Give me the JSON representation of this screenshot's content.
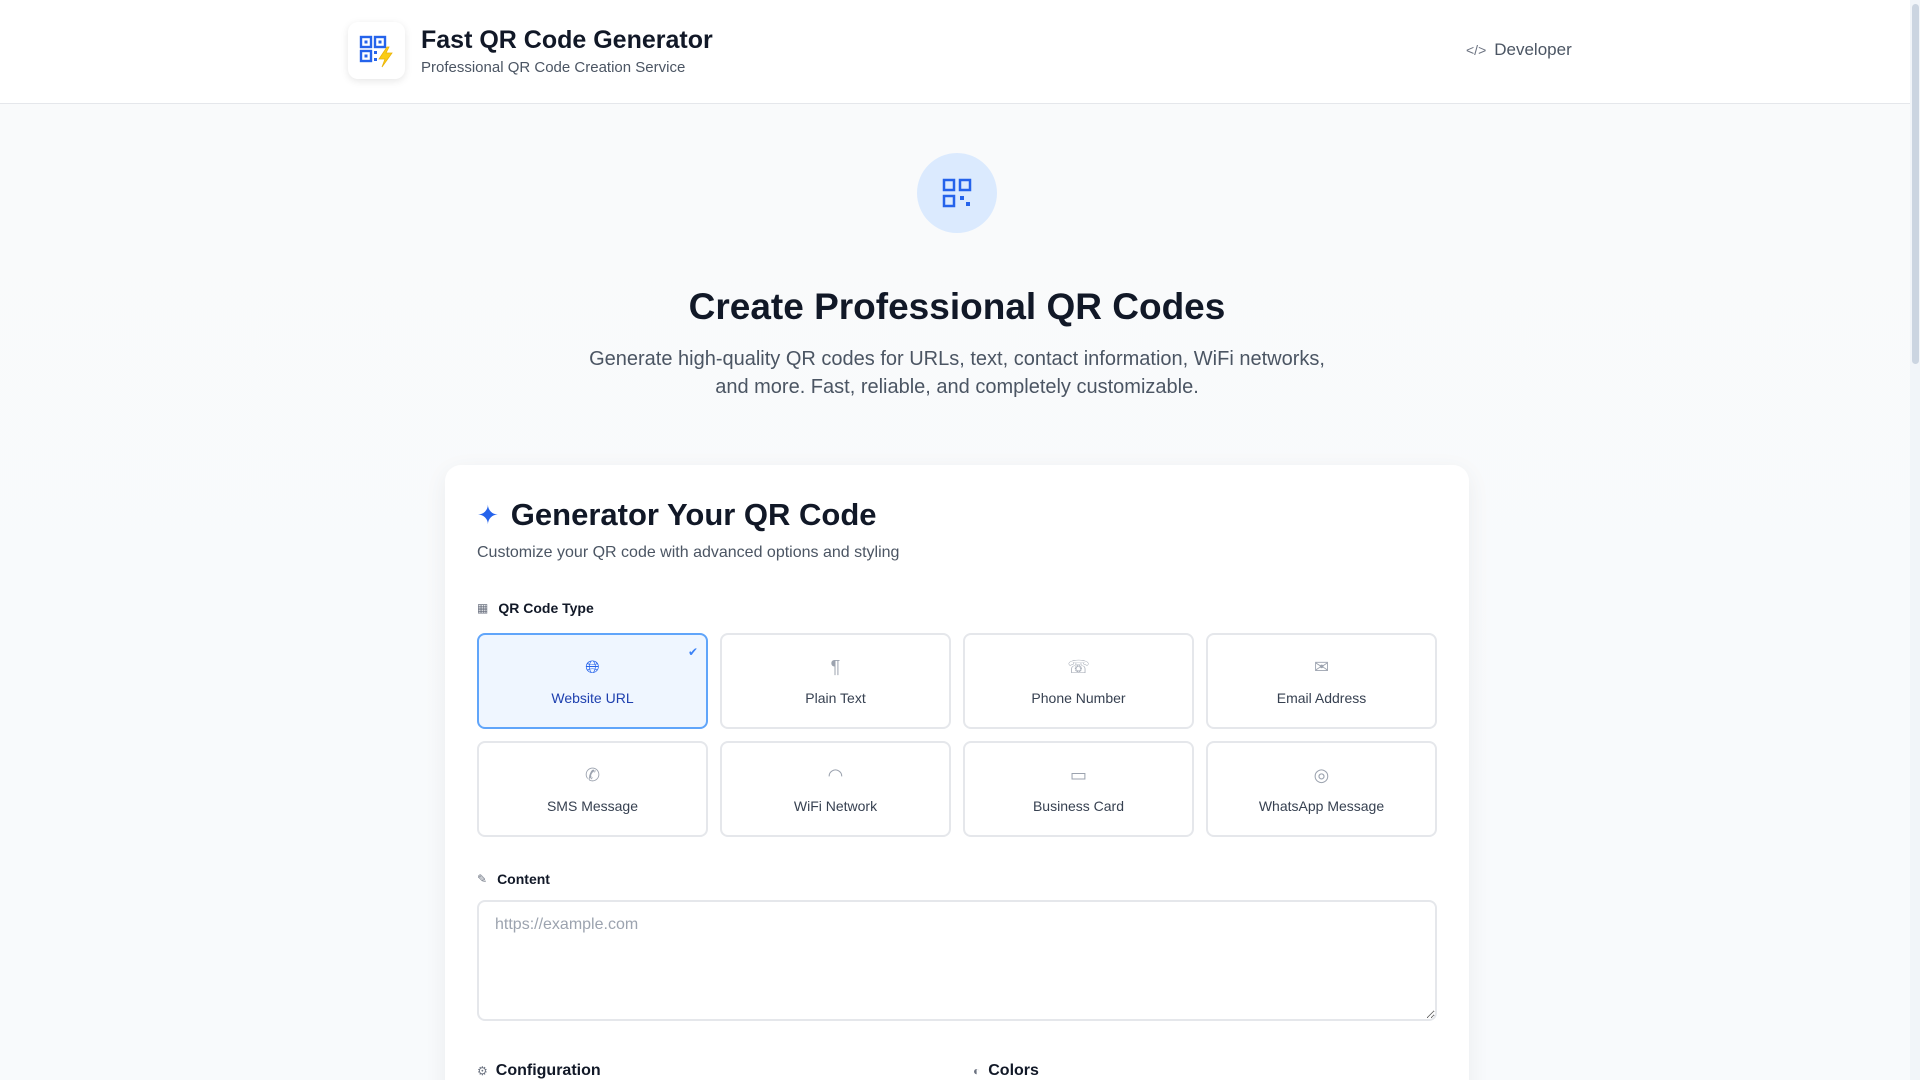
{
  "header": {
    "title": "Fast QR Code Generator",
    "subtitle": "Professional QR Code Creation Service",
    "logo_icon": "qr-code-lightning-icon",
    "developer_label": "Developer",
    "developer_icon": "code-icon"
  },
  "hero": {
    "icon": "qr-code-icon",
    "title": "Create Professional QR Codes",
    "description": "Generate high-quality QR codes for URLs, text, contact information, WiFi networks, and more. Fast, reliable, and completely customizable."
  },
  "generator": {
    "title": "Generator Your QR Code",
    "title_icon": "magic-wand-icon",
    "subtitle": "Customize your QR code with advanced options and styling",
    "type_section_label": "QR Code Type",
    "types": [
      {
        "label": "Website URL",
        "icon": "globe-icon",
        "selected": true
      },
      {
        "label": "Plain Text",
        "icon": "text-icon",
        "selected": false
      },
      {
        "label": "Phone Number",
        "icon": "phone-icon",
        "selected": false
      },
      {
        "label": "Email Address",
        "icon": "envelope-icon",
        "selected": false
      },
      {
        "label": "SMS Message",
        "icon": "sms-icon",
        "selected": false
      },
      {
        "label": "WiFi Network",
        "icon": "wifi-icon",
        "selected": false
      },
      {
        "label": "Business Card",
        "icon": "id-card-icon",
        "selected": false
      },
      {
        "label": "WhatsApp Message",
        "icon": "whatsapp-icon",
        "selected": false
      }
    ],
    "content_section_label": "Content",
    "content_value": "",
    "content_placeholder": "https://example.com",
    "configuration_label": "Configuration",
    "colors_label": "Colors"
  },
  "colors": {
    "accent": "#2563eb",
    "selected_border": "#60a5fa",
    "selected_bg": "#eff6ff"
  }
}
